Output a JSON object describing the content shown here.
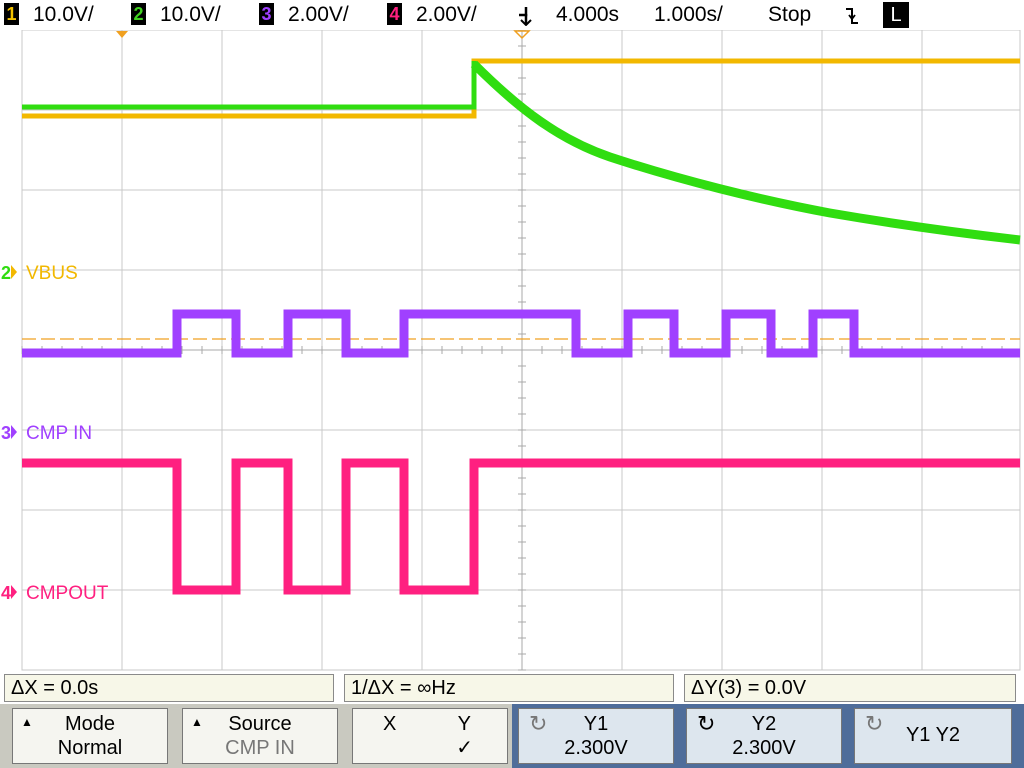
{
  "status": {
    "channels": [
      {
        "num": "1",
        "scale": "10.0V/",
        "color": "#f2c200"
      },
      {
        "num": "2",
        "scale": "10.0V/",
        "color": "#40d020"
      },
      {
        "num": "3",
        "scale": "2.00V/",
        "color": "#a040ff"
      },
      {
        "num": "4",
        "scale": "2.00V/",
        "color": "#ff2080"
      }
    ],
    "trigger_pos": "4.000s",
    "timebase": "1.000s/",
    "run_state": "Stop",
    "trigger_slope_icon": "falling-edge-icon",
    "mode_indicator": "L"
  },
  "traces": {
    "labels": [
      {
        "marker": "2",
        "text": "VBUS",
        "color": "#f2c200"
      },
      {
        "marker": "3",
        "text": "CMP IN",
        "color": "#a040ff"
      },
      {
        "marker": "4",
        "text": "CMPOUT",
        "color": "#ff2080"
      }
    ],
    "colors": {
      "ch1": "#f2b800",
      "ch2": "#30dd10",
      "ch3": "#a040ff",
      "ch4": "#ff2080",
      "cursor": "#f0a020"
    }
  },
  "measurements": {
    "delta_x": "ΔX = 0.0s",
    "inv_delta_x": "1/ΔX = ∞Hz",
    "delta_y": "ΔY(3) = 0.0V"
  },
  "softkeys": {
    "mode": {
      "title": "Mode",
      "value": "Normal"
    },
    "source": {
      "title": "Source",
      "value": "CMP IN"
    },
    "xy": {
      "x": "X",
      "y": "Y",
      "check": "✓"
    },
    "y1": {
      "title": "Y1",
      "value": "2.300V"
    },
    "y2": {
      "title": "Y2",
      "value": "2.300V"
    },
    "y1y2": {
      "title": "Y1 Y2"
    }
  }
}
